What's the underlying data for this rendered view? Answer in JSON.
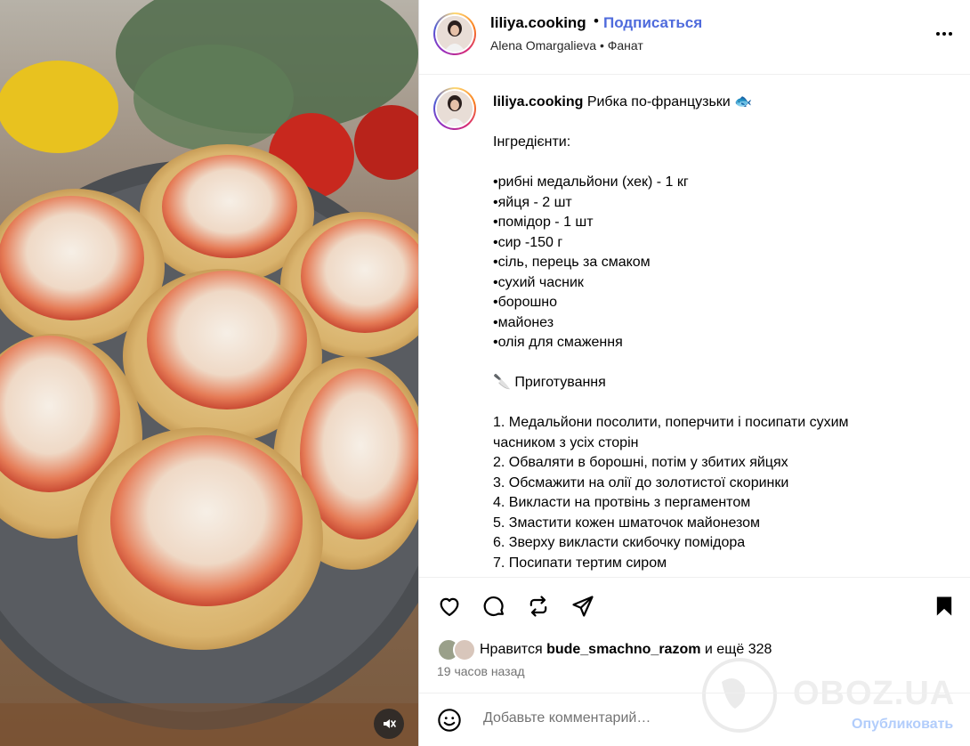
{
  "header": {
    "username": "liliya.cooking",
    "separator": "•",
    "follow_label": "Подписаться",
    "subtitle": "Alena Omargalieva • Фанат",
    "more_icon": "more-horizontal-icon"
  },
  "caption": {
    "username": "liliya.cooking",
    "lines": [
      "Рибка по-французьки 🐟",
      "",
      "Інгредієнти:",
      "",
      "•рибні медальйони (хек) - 1 кг",
      "•яйця - 2 шт",
      "•помідор - 1 шт",
      "•сир -150 г",
      "•сіль, перець за смаком",
      "•сухий часник",
      "•борошно",
      "•майонез",
      "•олія для смаження",
      "",
      "🔪 Приготування",
      "",
      "1. Медальйони посолити, поперчити і посипати сухим",
      "часником з усіх сторін",
      "2. Обваляти в борошні, потім у збитих яйцях",
      "3. Обсмажити на олії до золотистої скоринки",
      "4. Викласти на протвінь з пергаментом",
      "5. Змастити кожен шматочок майонезом",
      "6. Зверху викласти скибочку помідора",
      "7. Посипати тертим сиром"
    ]
  },
  "actions": {
    "icons": [
      "heart-icon",
      "comment-icon",
      "repost-icon",
      "share-icon",
      "bookmark-icon"
    ]
  },
  "likes": {
    "prefix": "Нравится",
    "user": "bude_smachno_razom",
    "suffix": "и ещё 328"
  },
  "timestamp": "19 часов назад",
  "comment": {
    "placeholder": "Добавьте комментарий…",
    "publish_label": "Опубликовать"
  },
  "watermark": {
    "text": "OBOZ.UA"
  },
  "colors": {
    "follow": "#4f6bdc",
    "publish_disabled": "#b2cdfb",
    "border": "#dbdbdb",
    "muted": "#737373"
  }
}
